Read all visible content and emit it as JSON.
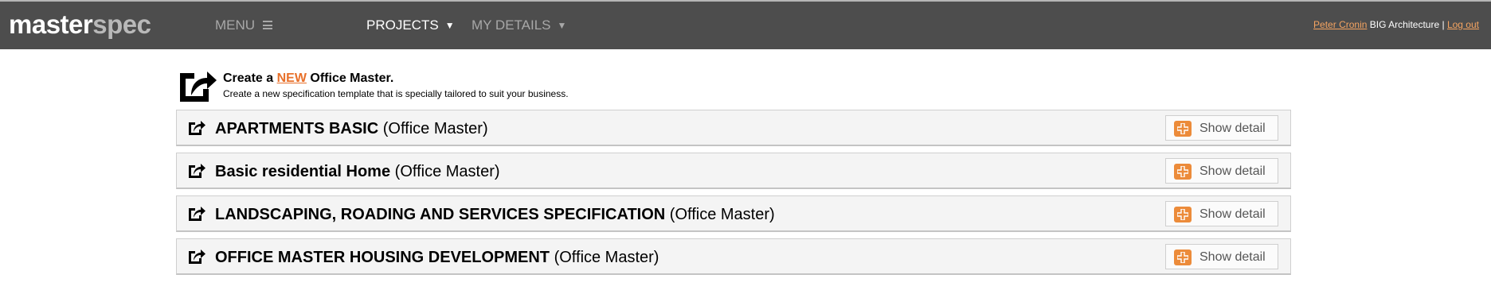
{
  "header": {
    "logo_part1": "master",
    "logo_part2": "spec",
    "nav": {
      "menu_label": "MENU",
      "projects_label": "PROJECTS",
      "details_label": "MY DETAILS"
    },
    "user": {
      "name": "Peter Cronin",
      "company": "BIG Architecture",
      "separator": "|",
      "logout": "Log out"
    }
  },
  "create": {
    "title_prefix": "Create a",
    "title_new": "NEW",
    "title_suffix": "Office Master.",
    "subtitle": "Create a new specification template that is specially tailored to suit your business."
  },
  "masters": [
    {
      "name": "APARTMENTS BASIC",
      "type": "(Office Master)",
      "button": "Show detail"
    },
    {
      "name": "Basic residential Home",
      "type": "(Office Master)",
      "button": "Show detail"
    },
    {
      "name": "LANDSCAPING, ROADING AND SERVICES SPECIFICATION",
      "type": "(Office Master)",
      "button": "Show detail"
    },
    {
      "name": "OFFICE MASTER HOUSING DEVELOPMENT",
      "type": "(Office Master)",
      "button": "Show detail"
    }
  ],
  "colors": {
    "topbar": "#4d4d4d",
    "accent": "#ec8b3a",
    "user_link": "#f5a461"
  },
  "icons": [
    "hamburger-icon",
    "caret-down-icon",
    "share-out-icon",
    "plus-icon"
  ]
}
